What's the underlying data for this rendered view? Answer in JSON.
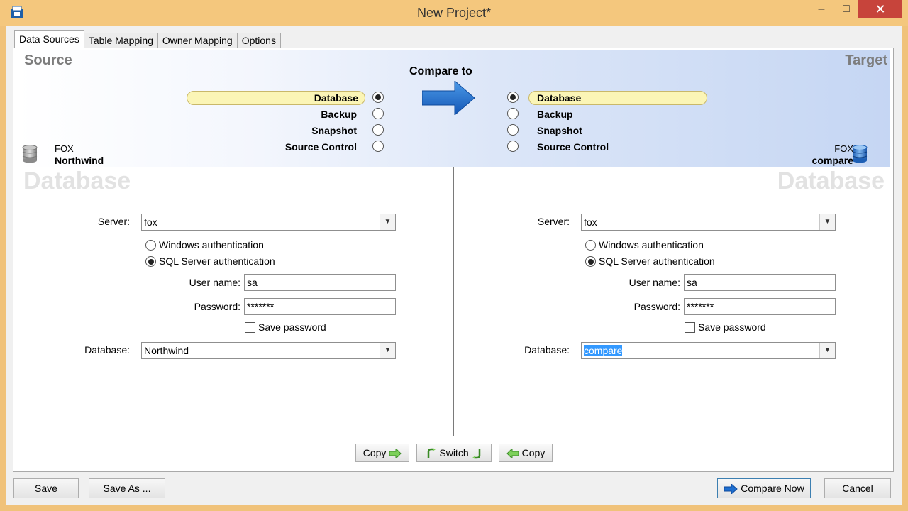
{
  "window": {
    "title": "New Project*",
    "minimize": "–",
    "maximize": "□",
    "close": "✕"
  },
  "tabs": [
    "Data Sources",
    "Table Mapping",
    "Owner Mapping",
    "Options"
  ],
  "header": {
    "source_label": "Source",
    "target_label": "Target",
    "compare_to": "Compare to",
    "source_options": [
      "Database",
      "Backup",
      "Snapshot",
      "Source Control"
    ],
    "target_options": [
      "Database",
      "Backup",
      "Snapshot",
      "Source Control"
    ],
    "selected_source": "Database",
    "selected_target": "Database",
    "source_server": "FOX",
    "source_db": "Northwind",
    "target_server": "FOX",
    "target_db": "compare"
  },
  "source": {
    "watermark": "Database",
    "server_label": "Server:",
    "server_value": "fox",
    "windows_auth": "Windows authentication",
    "sql_auth": "SQL Server authentication",
    "username_label": "User name:",
    "username_value": "sa",
    "password_label": "Password:",
    "password_value": "*******",
    "save_password": "Save password",
    "database_label": "Database:",
    "database_value": "Northwind"
  },
  "target": {
    "watermark": "Database",
    "server_label": "Server:",
    "server_value": "fox",
    "windows_auth": "Windows authentication",
    "sql_auth": "SQL Server authentication",
    "username_label": "User name:",
    "username_value": "sa",
    "password_label": "Password:",
    "password_value": "*******",
    "save_password": "Save password",
    "database_label": "Database:",
    "database_value": "compare"
  },
  "actions": {
    "copy_right": "Copy",
    "switch": "Switch",
    "copy_left": "Copy"
  },
  "footer": {
    "save": "Save",
    "save_as": "Save As ...",
    "compare_now": "Compare Now",
    "cancel": "Cancel"
  },
  "colors": {
    "title_bar": "#f4c77d",
    "close_button": "#c7443b",
    "selection": "#3399ff",
    "highlight_pill": "#fbf5b6",
    "arrow": "#1f6fd0"
  }
}
